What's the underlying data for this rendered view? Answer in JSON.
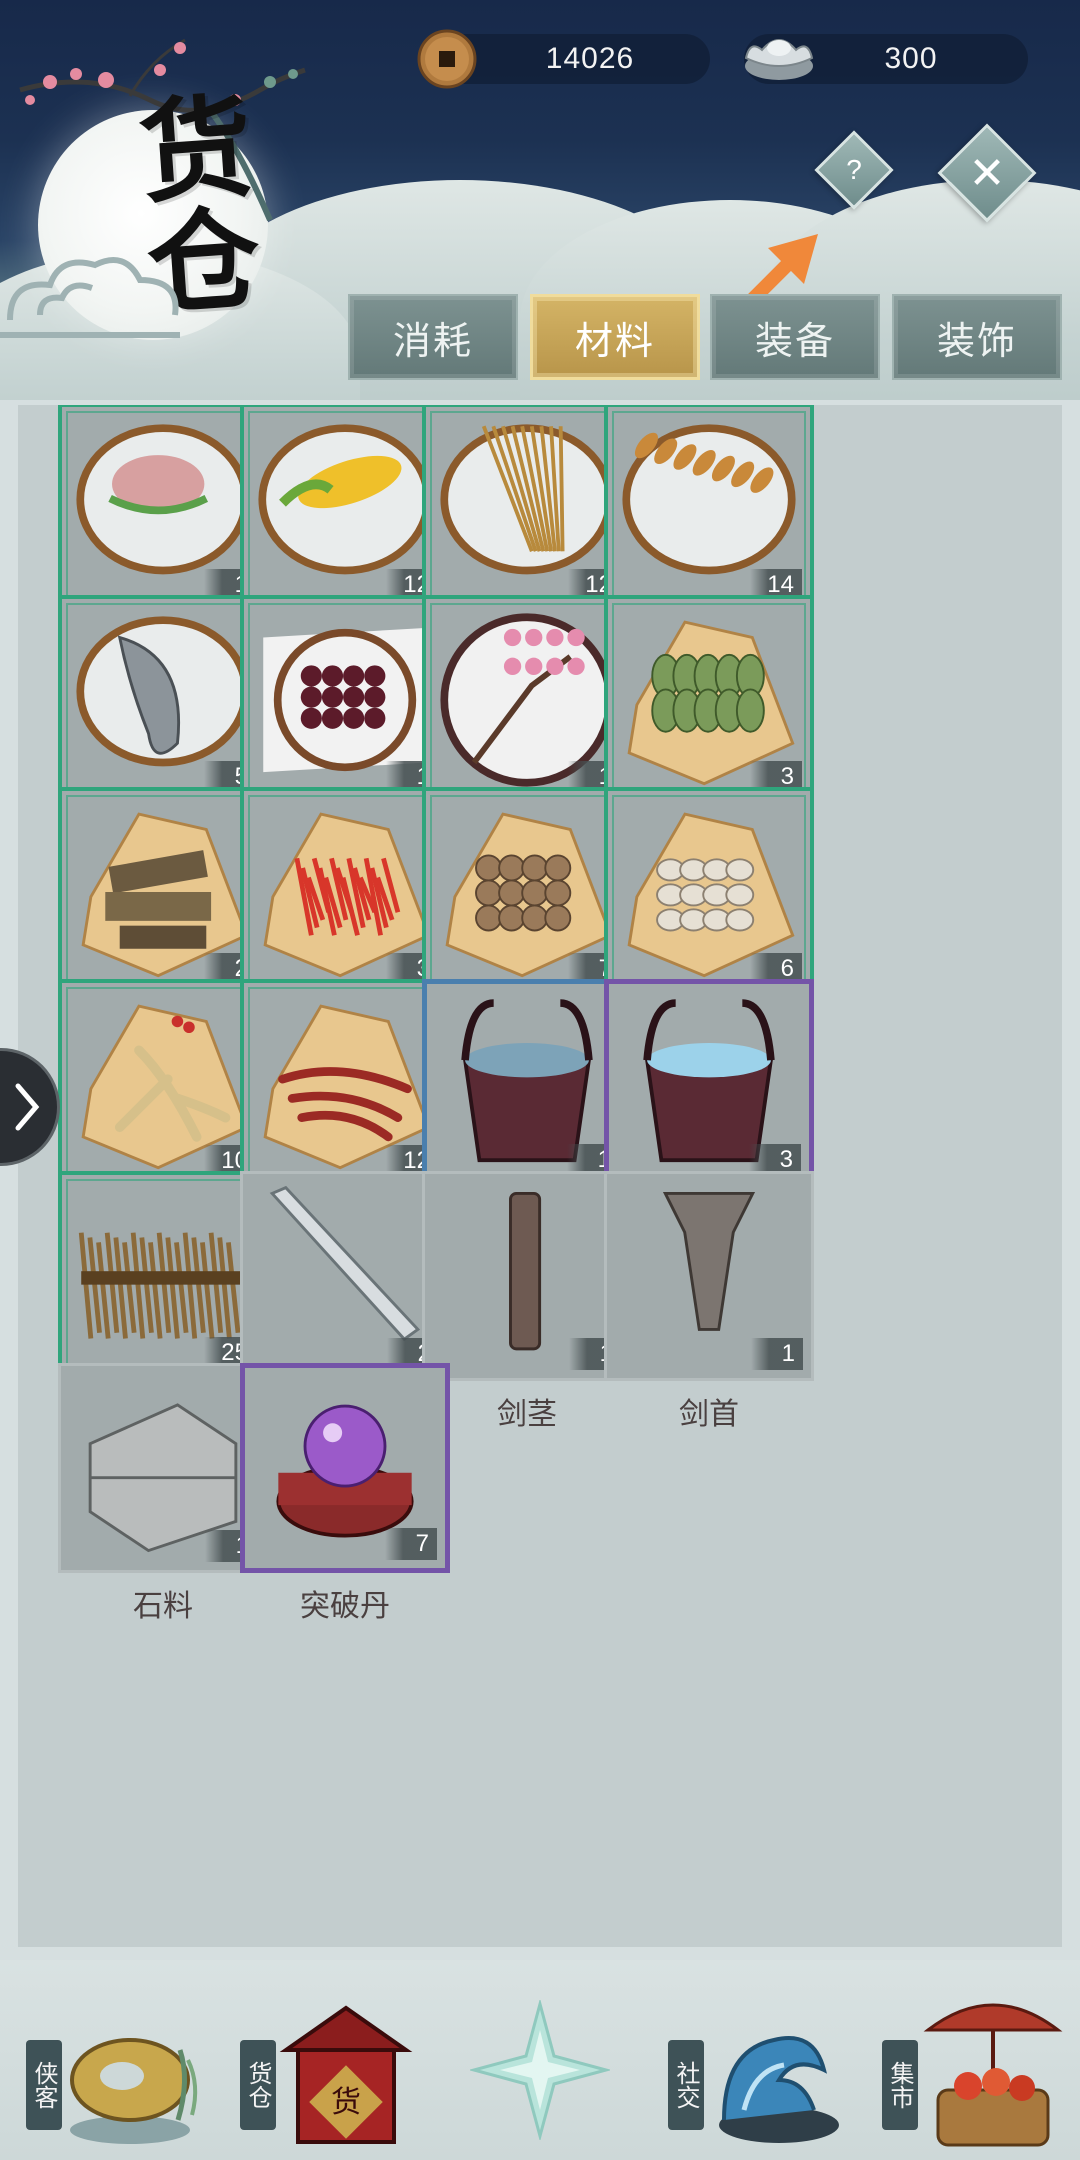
{
  "header": {
    "title": "货仓",
    "currency": {
      "coins": "14026",
      "silver": "300"
    },
    "help_label": "?",
    "close_icon": "close-icon"
  },
  "tabs": [
    {
      "label": "消耗",
      "active": false
    },
    {
      "label": "材料",
      "active": true
    },
    {
      "label": "装备",
      "active": false
    },
    {
      "label": "装饰",
      "active": false
    }
  ],
  "items": [
    {
      "name": "鸡肉",
      "count": "1",
      "frame": "green",
      "icon": "chicken-icon"
    },
    {
      "name": "玉米",
      "count": "12",
      "frame": "green",
      "icon": "corn-icon"
    },
    {
      "name": "稻谷",
      "count": "12",
      "frame": "green",
      "icon": "rice-icon"
    },
    {
      "name": "小麦",
      "count": "14",
      "frame": "green",
      "icon": "wheat-icon"
    },
    {
      "name": "鱼",
      "count": "5",
      "frame": "green",
      "icon": "fish-icon"
    },
    {
      "name": "桑葚",
      "count": "1",
      "frame": "green",
      "icon": "mulberry-icon"
    },
    {
      "name": "桃花",
      "count": "1",
      "frame": "green",
      "icon": "peach-blossom-icon"
    },
    {
      "name": "淫羊藿",
      "count": "3",
      "frame": "green",
      "icon": "herb-leaves-icon"
    },
    {
      "name": "杜仲",
      "count": "2",
      "frame": "green",
      "icon": "bark-icon"
    },
    {
      "name": "红花",
      "count": "3",
      "frame": "green",
      "icon": "safflower-icon"
    },
    {
      "name": "三七",
      "count": "7",
      "frame": "green",
      "icon": "notoginseng-icon"
    },
    {
      "name": "百合",
      "count": "6",
      "frame": "green",
      "icon": "lily-bulb-icon"
    },
    {
      "name": "人参",
      "count": "10",
      "frame": "green",
      "icon": "ginseng-icon"
    },
    {
      "name": "丹参",
      "count": "12",
      "frame": "green",
      "icon": "salvia-root-icon"
    },
    {
      "name": "雨水",
      "count": "1",
      "frame": "blue",
      "icon": "rain-bucket-icon"
    },
    {
      "name": "雪水",
      "count": "3",
      "frame": "purple",
      "icon": "snow-bucket-icon"
    },
    {
      "name": "干草",
      "count": "25",
      "frame": "green",
      "icon": "hay-icon"
    },
    {
      "name": "剑刃",
      "count": "2",
      "frame": "none",
      "icon": "blade-icon"
    },
    {
      "name": "剑茎",
      "count": "1",
      "frame": "none",
      "icon": "sword-tang-icon"
    },
    {
      "name": "剑首",
      "count": "1",
      "frame": "none",
      "icon": "sword-pommel-icon"
    },
    {
      "name": "石料",
      "count": "1",
      "frame": "none",
      "icon": "stone-icon"
    },
    {
      "name": "突破丹",
      "count": "7",
      "frame": "purple",
      "icon": "pill-orb-icon"
    }
  ],
  "bottom_nav": [
    {
      "label": "侠客",
      "icon": "hero-icon"
    },
    {
      "label": "货仓",
      "icon": "warehouse-icon"
    },
    {
      "label": "",
      "icon": "star-compass-icon"
    },
    {
      "label": "社交",
      "icon": "social-wave-icon"
    },
    {
      "label": "集市",
      "icon": "market-icon"
    }
  ],
  "colors": {
    "frame_green": "#2fa57c",
    "frame_blue": "#4a7fae",
    "frame_purple": "#7454a8",
    "tab_active": "#c9a85a",
    "tab_inactive": "#6f8584"
  }
}
